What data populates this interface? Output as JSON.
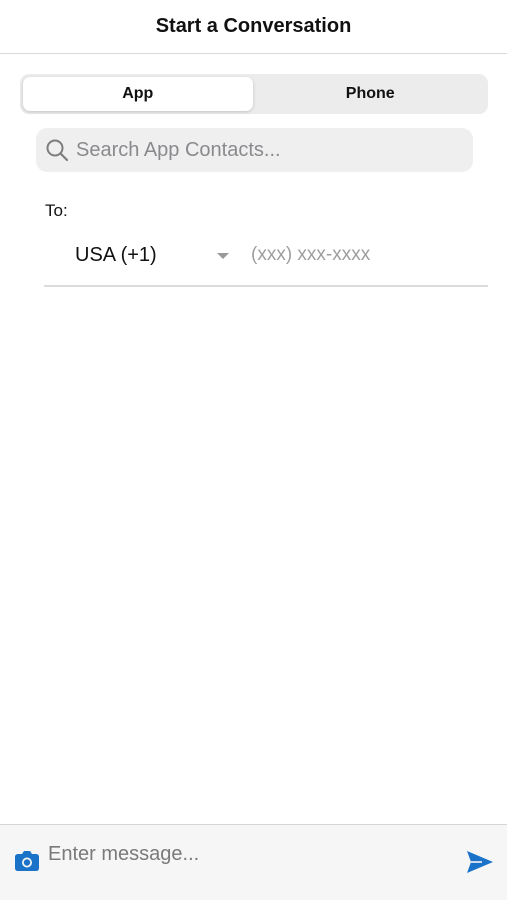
{
  "header": {
    "title": "Start a Conversation"
  },
  "tabs": [
    {
      "label": "App",
      "active": true
    },
    {
      "label": "Phone",
      "active": false
    }
  ],
  "search": {
    "placeholder": "Search App Contacts...",
    "icon": "search-icon"
  },
  "recipient": {
    "to_label": "To:",
    "country": "USA (+1)",
    "phone_placeholder": "(xxx) xxx-xxxx"
  },
  "composer": {
    "placeholder": "Enter message...",
    "camera_icon": "camera-icon",
    "send_icon": "send-icon"
  },
  "colors": {
    "accent": "#1a73c8",
    "segment_bg": "#ececec",
    "search_bg": "#efefef",
    "footer_bg": "#f6f6f6"
  }
}
